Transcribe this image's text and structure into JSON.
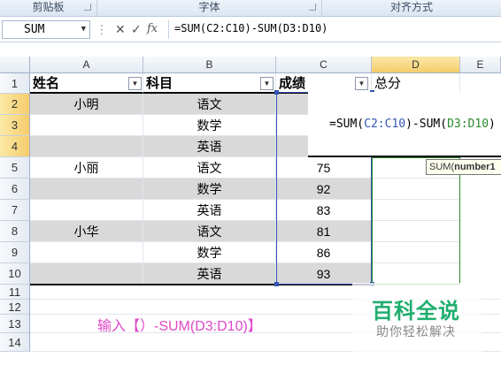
{
  "ribbon": {
    "groups": [
      "剪贴板",
      "字体",
      "对齐方式"
    ]
  },
  "formula_bar": {
    "name_box": "SUM",
    "cancel_icon": "✕",
    "enter_icon": "✓",
    "fx_label": "fx",
    "formula": "=SUM(C2:C10)-SUM(D3:D10)"
  },
  "columns": [
    "A",
    "B",
    "C",
    "D",
    "E"
  ],
  "rows": [
    "1",
    "2",
    "3",
    "4",
    "5",
    "6",
    "7",
    "8",
    "9",
    "10",
    "11",
    "12",
    "13",
    "14"
  ],
  "header_row": {
    "a": "姓名",
    "b": "科目",
    "c": "成绩",
    "d": "总分"
  },
  "table": [
    {
      "name": "小明",
      "subject": "语文",
      "score": ""
    },
    {
      "name": "",
      "subject": "数学",
      "score": ""
    },
    {
      "name": "",
      "subject": "英语",
      "score": ""
    },
    {
      "name": "小丽",
      "subject": "语文",
      "score": "75"
    },
    {
      "name": "",
      "subject": "数学",
      "score": "92"
    },
    {
      "name": "",
      "subject": "英语",
      "score": "83"
    },
    {
      "name": "小华",
      "subject": "语文",
      "score": "81"
    },
    {
      "name": "",
      "subject": "数学",
      "score": "86"
    },
    {
      "name": "",
      "subject": "英语",
      "score": "93"
    }
  ],
  "edit_cell": {
    "prefix": "=SUM(",
    "ref1": "C2:C10",
    "middle": ")-SUM(",
    "ref2": "D3:D10",
    "suffix": ")"
  },
  "tooltip": {
    "fn": "SUM(",
    "arg": "number1"
  },
  "annotation": "输入【）-SUM(D3:D10)】",
  "watermark": {
    "title": "百科全说",
    "subtitle": "助你轻松解决"
  },
  "colors": {
    "ref_blue": "#3354b6",
    "ref_green": "#2b8a2b",
    "annotation": "#e048c8",
    "watermark": "#1eae6e"
  }
}
